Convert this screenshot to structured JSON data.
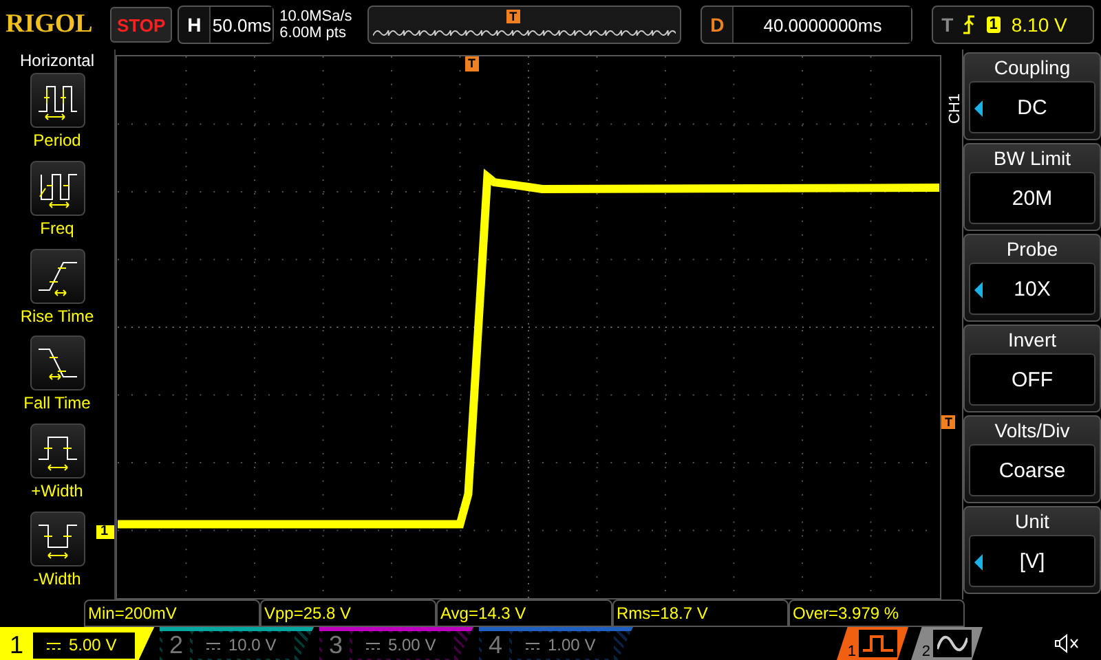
{
  "brand": "RIGOL",
  "run_state": "STOP",
  "timebase": {
    "label": "H",
    "value": "50.0ms"
  },
  "sample": {
    "rate": "10.0MSa/s",
    "depth": "6.00M pts"
  },
  "memory_trigger_marker": "T",
  "delay": {
    "label": "D",
    "value": "40.0000000ms"
  },
  "trigger": {
    "label": "T",
    "channel": "1",
    "level": "8.10 V"
  },
  "left_menu": {
    "title": "Horizontal",
    "items": [
      {
        "kind": "period",
        "label": "Period"
      },
      {
        "kind": "freq",
        "label": "Freq"
      },
      {
        "kind": "rise",
        "label": "Rise Time"
      },
      {
        "kind": "fall",
        "label": "Fall Time"
      },
      {
        "kind": "pwidth",
        "label": "+Width"
      },
      {
        "kind": "nwidth",
        "label": "-Width"
      }
    ]
  },
  "grid_markers": {
    "channel": "1",
    "trigger_top": "T",
    "trigger_level": "T"
  },
  "channel_tab": "CH1",
  "right_menu": [
    {
      "title": "Coupling",
      "value": "DC",
      "adjustable": true
    },
    {
      "title": "BW Limit",
      "value": "20M",
      "adjustable": false
    },
    {
      "title": "Probe",
      "value": "10X",
      "adjustable": true
    },
    {
      "title": "Invert",
      "value": "OFF",
      "adjustable": false
    },
    {
      "title": "Volts/Div",
      "value": "Coarse",
      "adjustable": false
    },
    {
      "title": "Unit",
      "value": "[V]",
      "adjustable": true
    }
  ],
  "measurements": [
    "Min=200mV",
    "Vpp=25.8 V",
    "Avg=14.3 V",
    "Rms=18.7 V",
    "Over=3.979 %"
  ],
  "channels": [
    {
      "number": "1",
      "scale": "5.00 V",
      "on": true,
      "color": "#ffff00"
    },
    {
      "number": "2",
      "scale": "10.0 V",
      "on": false,
      "color": "#00a8a0"
    },
    {
      "number": "3",
      "scale": "5.00 V",
      "on": false,
      "color": "#c000c0"
    },
    {
      "number": "4",
      "scale": "1.00 V",
      "on": false,
      "color": "#2060c0"
    }
  ],
  "generators": [
    {
      "number": "1",
      "kind": "square",
      "on": true
    },
    {
      "number": "2",
      "kind": "sine",
      "on": false
    }
  ]
}
